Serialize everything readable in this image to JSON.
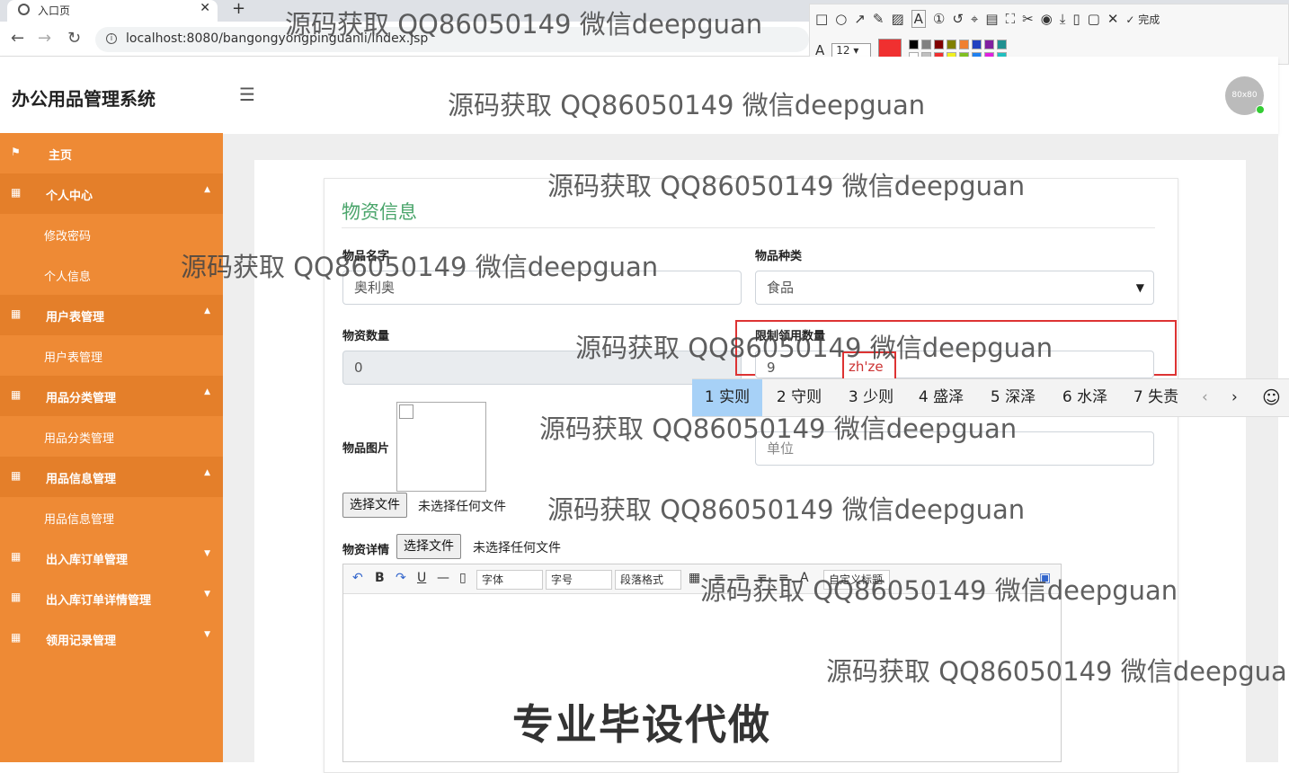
{
  "browser": {
    "tab_title": "入口页",
    "tab_close": "✕",
    "new_tab": "+",
    "url": "localhost:8080/bangongyongpinguanli/index.jsp"
  },
  "screenshot_tool": {
    "font_size": "12",
    "done_label": "完成",
    "colors": [
      "#000000",
      "#808080",
      "#800000",
      "#808000",
      "#f08030",
      "#2040c0",
      "#8020a0",
      "#209090",
      "#ffffff",
      "#c0c0c0",
      "#f03030",
      "#f0f020",
      "#80c020",
      "#2080f0",
      "#e020e0",
      "#20c0c0"
    ],
    "selected_color": "#f03030"
  },
  "app": {
    "logo": "办公用品管理系统",
    "avatar_text": "80x80"
  },
  "sidebar": {
    "items": [
      {
        "label": "主页",
        "type": "top",
        "arrow": ""
      },
      {
        "label": "个人中心",
        "type": "group",
        "arrow": "▲"
      },
      {
        "label": "修改密码",
        "type": "sub",
        "arrow": ""
      },
      {
        "label": "个人信息",
        "type": "sub",
        "arrow": ""
      },
      {
        "label": "用户表管理",
        "type": "group",
        "arrow": "▲"
      },
      {
        "label": "用户表管理",
        "type": "sub",
        "arrow": ""
      },
      {
        "label": "用品分类管理",
        "type": "group",
        "arrow": "▲"
      },
      {
        "label": "用品分类管理",
        "type": "sub",
        "arrow": ""
      },
      {
        "label": "用品信息管理",
        "type": "group",
        "arrow": "▲"
      },
      {
        "label": "用品信息管理",
        "type": "sub",
        "arrow": ""
      },
      {
        "label": "出入库订单管理",
        "type": "top",
        "arrow": "▼"
      },
      {
        "label": "出入库订单详情管理",
        "type": "top",
        "arrow": "▼"
      },
      {
        "label": "领用记录管理",
        "type": "top",
        "arrow": "▼"
      }
    ]
  },
  "form": {
    "title": "物资信息",
    "name_label": "物品名字",
    "name_value": "奥利奥",
    "category_label": "物品种类",
    "category_value": "食品",
    "quantity_label": "物资数量",
    "quantity_value": "0",
    "limit_label": "限制领用数量",
    "limit_value": "9",
    "unit_placeholder": "单位",
    "image_label": "物品图片",
    "choose_file": "选择文件",
    "no_file": "未选择任何文件",
    "detail_label": "物资详情",
    "detail_choose_file": "选择文件",
    "detail_no_file": "未选择任何文件"
  },
  "ime": {
    "composition": "zh'ze",
    "candidates": [
      "1 实则",
      "2 守则",
      "3 少则",
      "4 盛泽",
      "5 深泽",
      "6 水泽",
      "7 失责"
    ],
    "prev": "‹",
    "next": "›",
    "emoji": "☺"
  },
  "editor": {
    "font_select": "字体",
    "size_select": "字号",
    "para_select": "段落格式",
    "custom_title": "自定义标题"
  },
  "watermark": {
    "text": "源码获取 QQ86050149 微信deepguan",
    "text_cut": "源码获取 QQ86050149 微信deepgua",
    "banner": "专业毕设代做"
  }
}
